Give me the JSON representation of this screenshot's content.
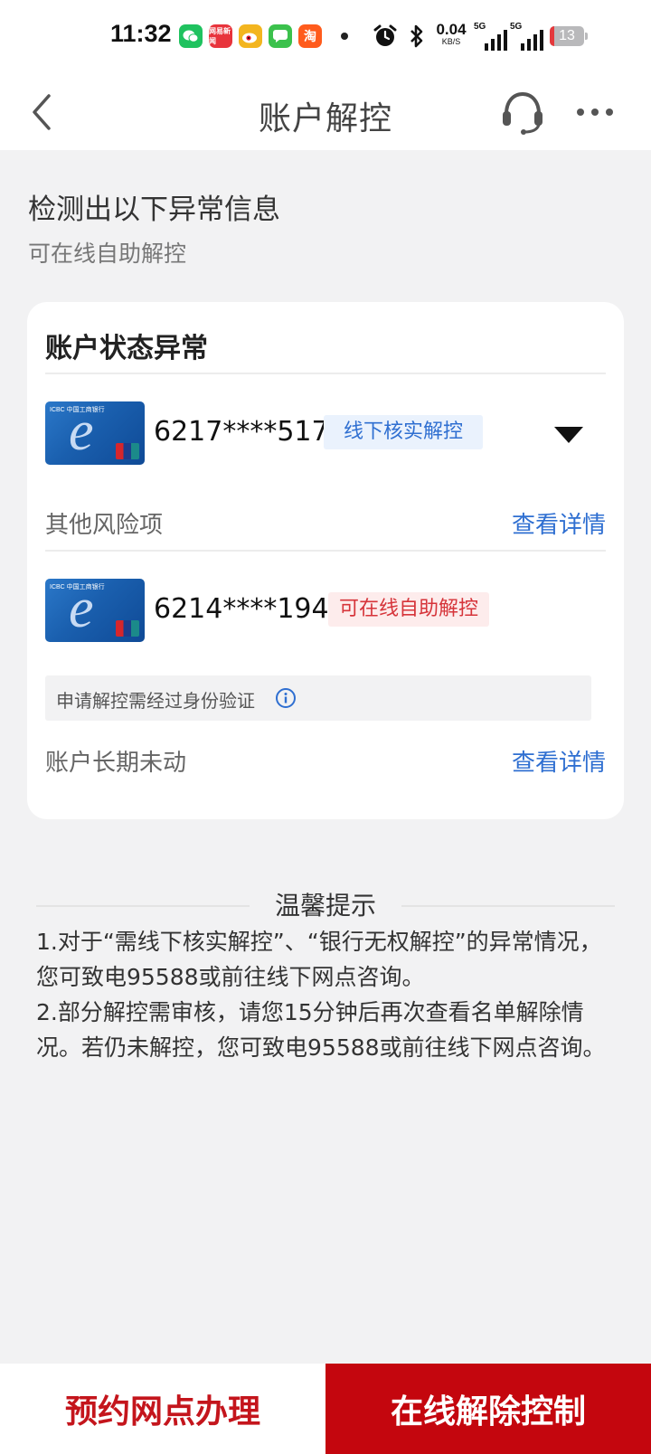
{
  "status_bar": {
    "time": "11:32",
    "net_speed_value": "0.04",
    "net_speed_unit": "KB/S",
    "network1": "5G",
    "network2": "5G",
    "battery": "13",
    "app_icons": [
      "wechat-icon",
      "netease-news-icon",
      "weibo-icon",
      "messages-icon",
      "taobao-icon"
    ],
    "netease_icon_text": "网易新闻",
    "taobao_icon_text": "淘"
  },
  "nav": {
    "title": "账户解控"
  },
  "header": {
    "title": "检测出以下异常信息",
    "subtitle": "可在线自助解控"
  },
  "card": {
    "title": "账户状态异常",
    "bank_card_logo_text": "ICBC 中国工商银行",
    "accounts": [
      {
        "number": "6217****5174",
        "tag": "线下核实解控",
        "tag_color": "#2f6fd1",
        "extra_label": "其他风险项",
        "extra_link": "查看详情"
      },
      {
        "number": "6214****1945",
        "tag": "可在线自助解控",
        "tag_color": "#d6343a",
        "notice": "申请解控需经过身份验证",
        "extra_label": "账户长期未动",
        "extra_link": "查看详情"
      }
    ]
  },
  "tips": {
    "title": "温馨提示",
    "line1": "1.对于“需线下核实解控”、“银行无权解控”的异常情况，您可致电95588或前往线下网点咨询。",
    "line2": "2.部分解控需审核，请您15分钟后再次查看名单解除情况。若仍未解控，您可致电95588或前往线下网点咨询。"
  },
  "bottom": {
    "left_button": "预约网点办理",
    "right_button": "在线解除控制"
  },
  "colors": {
    "brand_red": "#c4060e",
    "link_blue": "#2f6fd1",
    "page_bg": "#f2f2f3"
  }
}
